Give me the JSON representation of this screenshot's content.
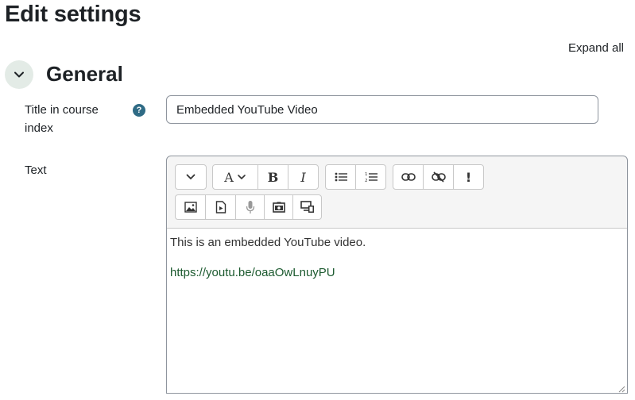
{
  "page": {
    "title": "Edit settings",
    "expand_all": "Expand all"
  },
  "section": {
    "title": "General"
  },
  "fields": {
    "title": {
      "label": "Title in course index",
      "value": "Embedded YouTube Video",
      "help": "?"
    },
    "text": {
      "label": "Text",
      "content": {
        "paragraph": "This is an embedded YouTube video.",
        "link": "https://youtu.be/oaaOwLnuyPU"
      }
    }
  },
  "toolbar": {
    "row1": [
      "collapse-icon",
      "font-icon",
      "bold-icon",
      "italic-icon",
      "unordered-list-icon",
      "ordered-list-icon",
      "link-icon",
      "unlink-icon",
      "no-autolink-icon"
    ],
    "row2": [
      "image-icon",
      "media-icon",
      "microphone-icon",
      "video-record-icon",
      "screen-manage-icon"
    ],
    "labels": {
      "bold": "B",
      "italic": "I",
      "font": "A",
      "no_autolink": "!"
    }
  },
  "colors": {
    "accent": "#2f6b85",
    "link": "#1c5a2f",
    "toggle_bg": "#e3ebe6"
  }
}
